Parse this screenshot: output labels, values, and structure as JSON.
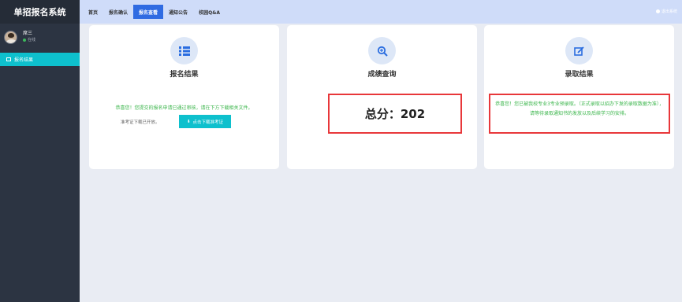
{
  "app": {
    "title": "单招报名系统"
  },
  "user": {
    "name": "席三",
    "status": "在线"
  },
  "sidebar": {
    "items": [
      {
        "label": "报名结果"
      }
    ]
  },
  "nav": {
    "tabs": [
      {
        "label": "首页"
      },
      {
        "label": "报名确认"
      },
      {
        "label": "报名查看"
      },
      {
        "label": "通知公告"
      },
      {
        "label": "校园Q&A"
      }
    ],
    "active_index": 2,
    "logout_label": "退出系统"
  },
  "cards": {
    "result": {
      "title": "报名结果",
      "message": "恭喜您！您提交的报名申请已通过审核，请在下方下载相关文件。",
      "admit_ticket_label": "准考证下载已开放。",
      "download_button": "点击下载准考证"
    },
    "score": {
      "title": "成绩查询",
      "total_label": "总分：202"
    },
    "admission": {
      "title": "录取结果",
      "message": "恭喜您！您已被我校专业3专业预录取。（正式录取以招办下发的录取数据为准），请等待录取通知书的发放以及后续学习的安排。"
    }
  },
  "colors": {
    "accent": "#0ec0cd",
    "tab_active": "#2f6be2",
    "success_text": "#3ab54a",
    "highlight_box": "#e8373a"
  },
  "icons": [
    "list-icon",
    "search-icon",
    "edit-icon",
    "download-icon",
    "power-icon"
  ]
}
